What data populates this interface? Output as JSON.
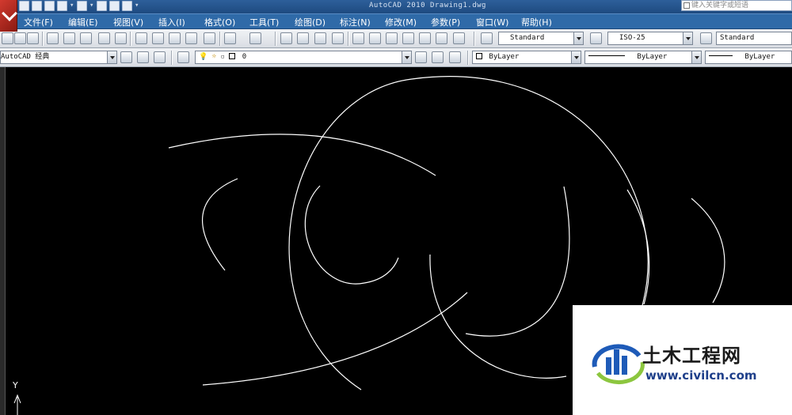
{
  "titlebar": {
    "window_title": "AutoCAD 2010   Drawing1.dwg",
    "help_placeholder": "键入关键字或短语"
  },
  "menu": [
    "文件(F)",
    "编辑(E)",
    "视图(V)",
    "插入(I)",
    "格式(O)",
    "工具(T)",
    "绘图(D)",
    "标注(N)",
    "修改(M)",
    "参数(P)",
    "窗口(W)",
    "帮助(H)"
  ],
  "toolbar_styles": {
    "text_style": "Standard",
    "dim_style": "ISO-25",
    "table_style": "Standard"
  },
  "toolbar_layers": {
    "workspace": "AutoCAD 经典",
    "current_layer": "0",
    "color": "ByLayer",
    "linetype": "ByLayer",
    "lineweight": "ByLayer"
  },
  "ucs": {
    "y_axis_label": "Y"
  },
  "watermark": {
    "title": "土木工程网",
    "url": "www.civilcn.com",
    "colors": {
      "blue": "#1e5bb8",
      "green": "#8cc63f"
    }
  },
  "colors": {
    "menubar": "#2f6aa8",
    "canvas": "#000000",
    "geometry": "#ffffff"
  }
}
